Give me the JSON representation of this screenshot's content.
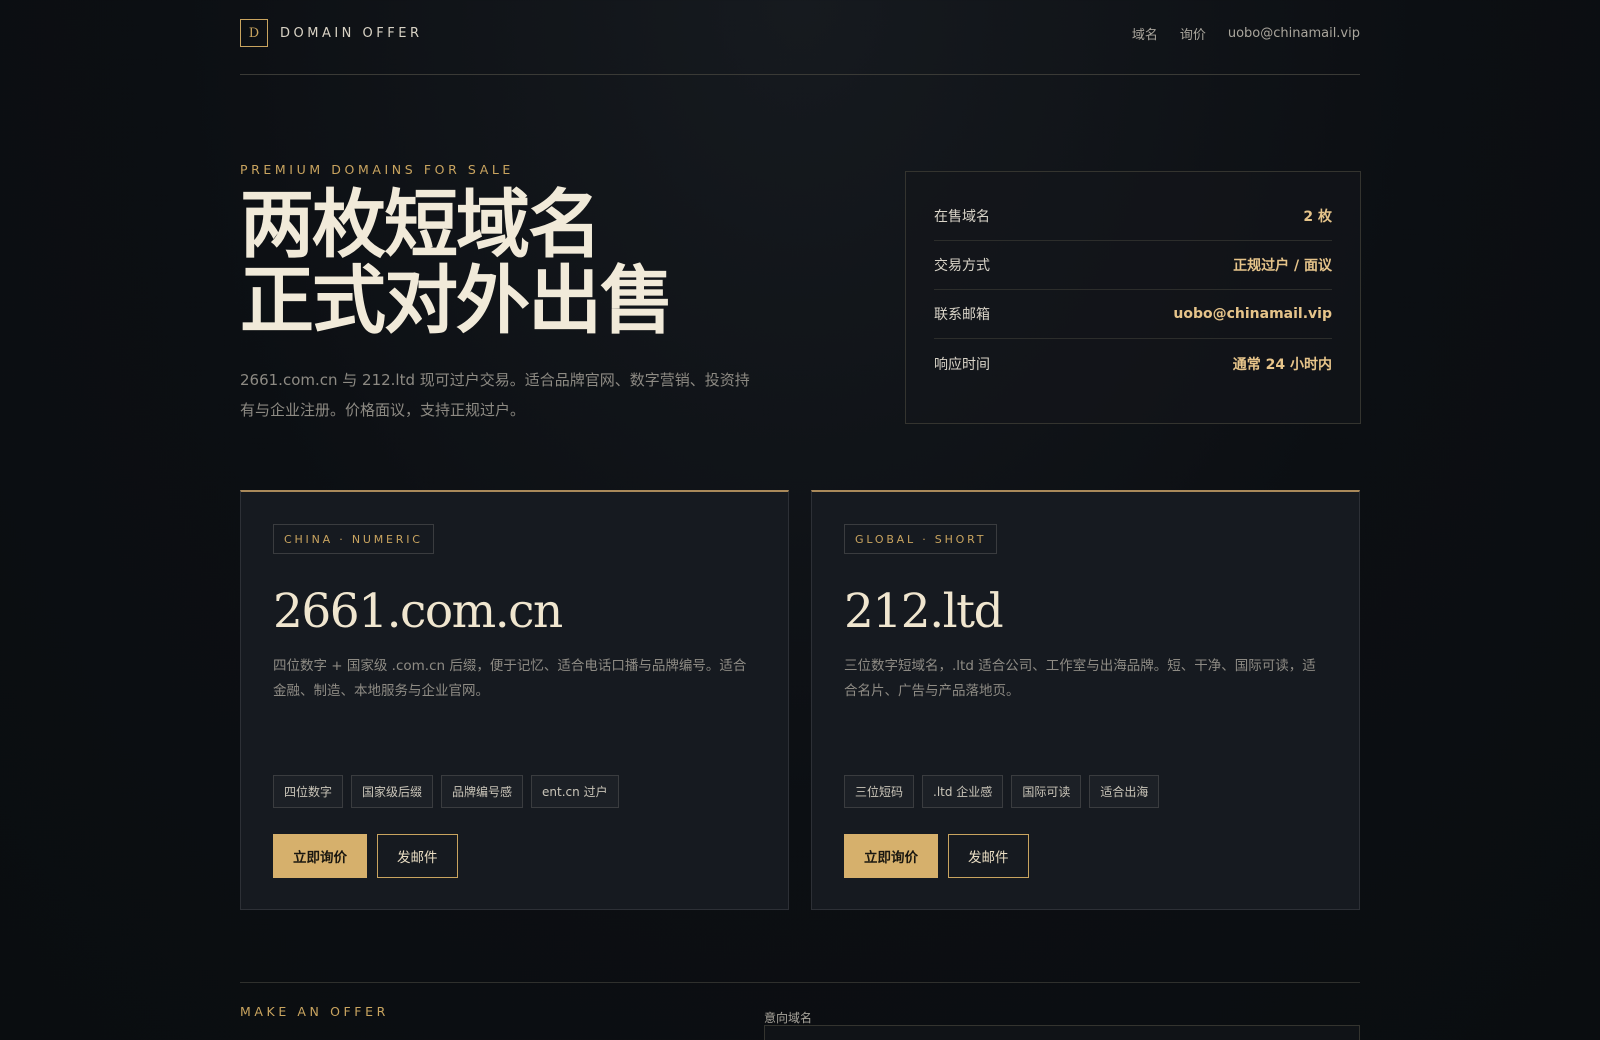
{
  "header": {
    "brand_letter": "D",
    "brand_name": "DOMAIN OFFER",
    "nav": [
      "域名",
      "询价",
      "uobo@chinamail.vip"
    ]
  },
  "hero": {
    "eyebrow": "PREMIUM DOMAINS FOR SALE",
    "title_line1": "两枚短域名",
    "title_line2": "正式对外出售",
    "lede": "2661.com.cn 与 212.ltd 现可过户交易。适合品牌官网、数字营销、投资持有与企业注册。价格面议，支持正规过户。"
  },
  "facts": [
    {
      "label": "在售域名",
      "value": "2 枚"
    },
    {
      "label": "交易方式",
      "value": "正规过户 / 面议"
    },
    {
      "label": "联系邮箱",
      "value": "uobo@chinamail.vip"
    },
    {
      "label": "响应时间",
      "value": "通常 24 小时内"
    }
  ],
  "cards": [
    {
      "tag": "CHINA · NUMERIC",
      "domain": "2661.com.cn",
      "desc": "四位数字 + 国家级 .com.cn 后缀，便于记忆、适合电话口播与品牌编号。适合金融、制造、本地服务与企业官网。",
      "chips": [
        "四位数字",
        "国家级后缀",
        "品牌编号感",
        "ent.cn 过户"
      ],
      "primary": "立即询价",
      "secondary": "发邮件"
    },
    {
      "tag": "GLOBAL · SHORT",
      "domain": "212.ltd",
      "desc": "三位数字短域名，.ltd 适合公司、工作室与出海品牌。短、干净、国际可读，适合名片、广告与产品落地页。",
      "chips": [
        "三位短码",
        ".ltd 企业感",
        "国际可读",
        "适合出海"
      ],
      "primary": "立即询价",
      "secondary": "发邮件"
    }
  ],
  "offer": {
    "eyebrow": "MAKE AN OFFER",
    "field_label": "意向域名"
  },
  "colors": {
    "accent": "#c9a45f",
    "button": "#d6b06c",
    "background": "#0c0f13"
  }
}
